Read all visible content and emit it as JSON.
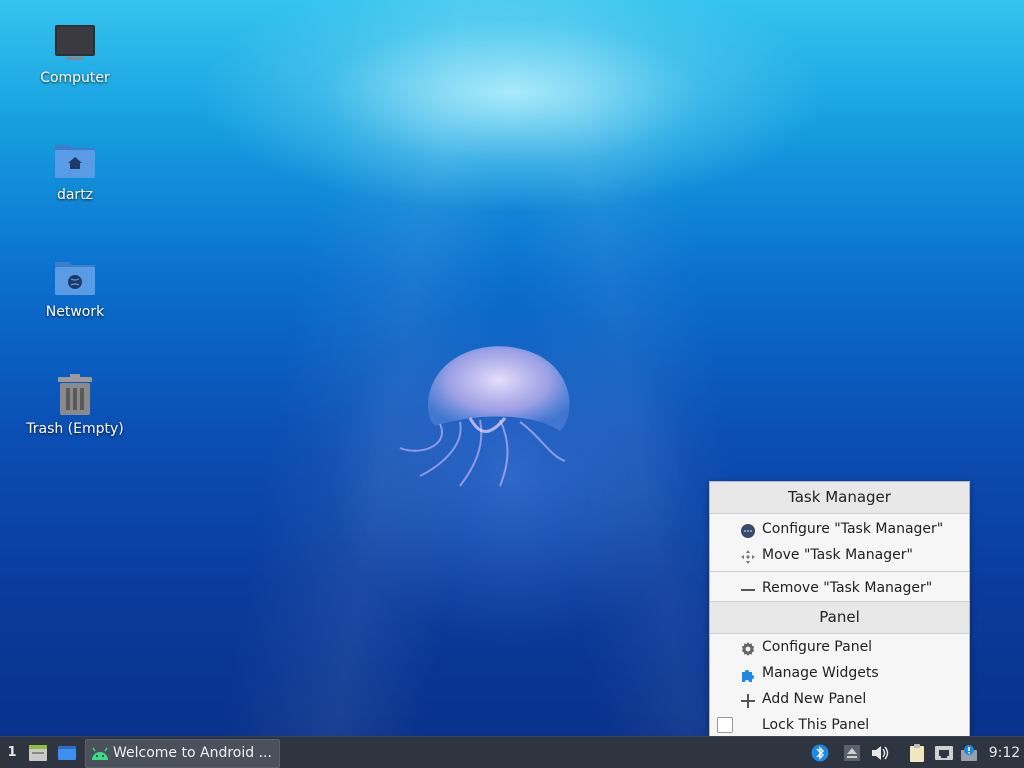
{
  "desktop": {
    "icons": [
      {
        "label": "Computer",
        "icon": "computer-icon"
      },
      {
        "label": "dartz",
        "icon": "home-folder-icon"
      },
      {
        "label": "Network",
        "icon": "network-folder-icon"
      },
      {
        "label": "Trash (Empty)",
        "icon": "trash-icon"
      }
    ]
  },
  "context_menu": {
    "section1_header": "Task Manager",
    "configure_tm": "Configure \"Task Manager\"",
    "move_tm": "Move \"Task Manager\"",
    "remove_tm": "Remove \"Task Manager\"",
    "section2_header": "Panel",
    "configure_panel": "Configure Panel",
    "manage_widgets": "Manage Widgets",
    "add_panel": "Add New Panel",
    "lock_panel": "Lock This Panel",
    "lock_checked": false
  },
  "panel": {
    "workspace": "1",
    "task_title": "Welcome to Android ...",
    "clock": "9:12"
  },
  "colors": {
    "panel_bg": "#2e3440",
    "menu_bg": "#f6f6f6",
    "accent": "#1e88e5"
  }
}
